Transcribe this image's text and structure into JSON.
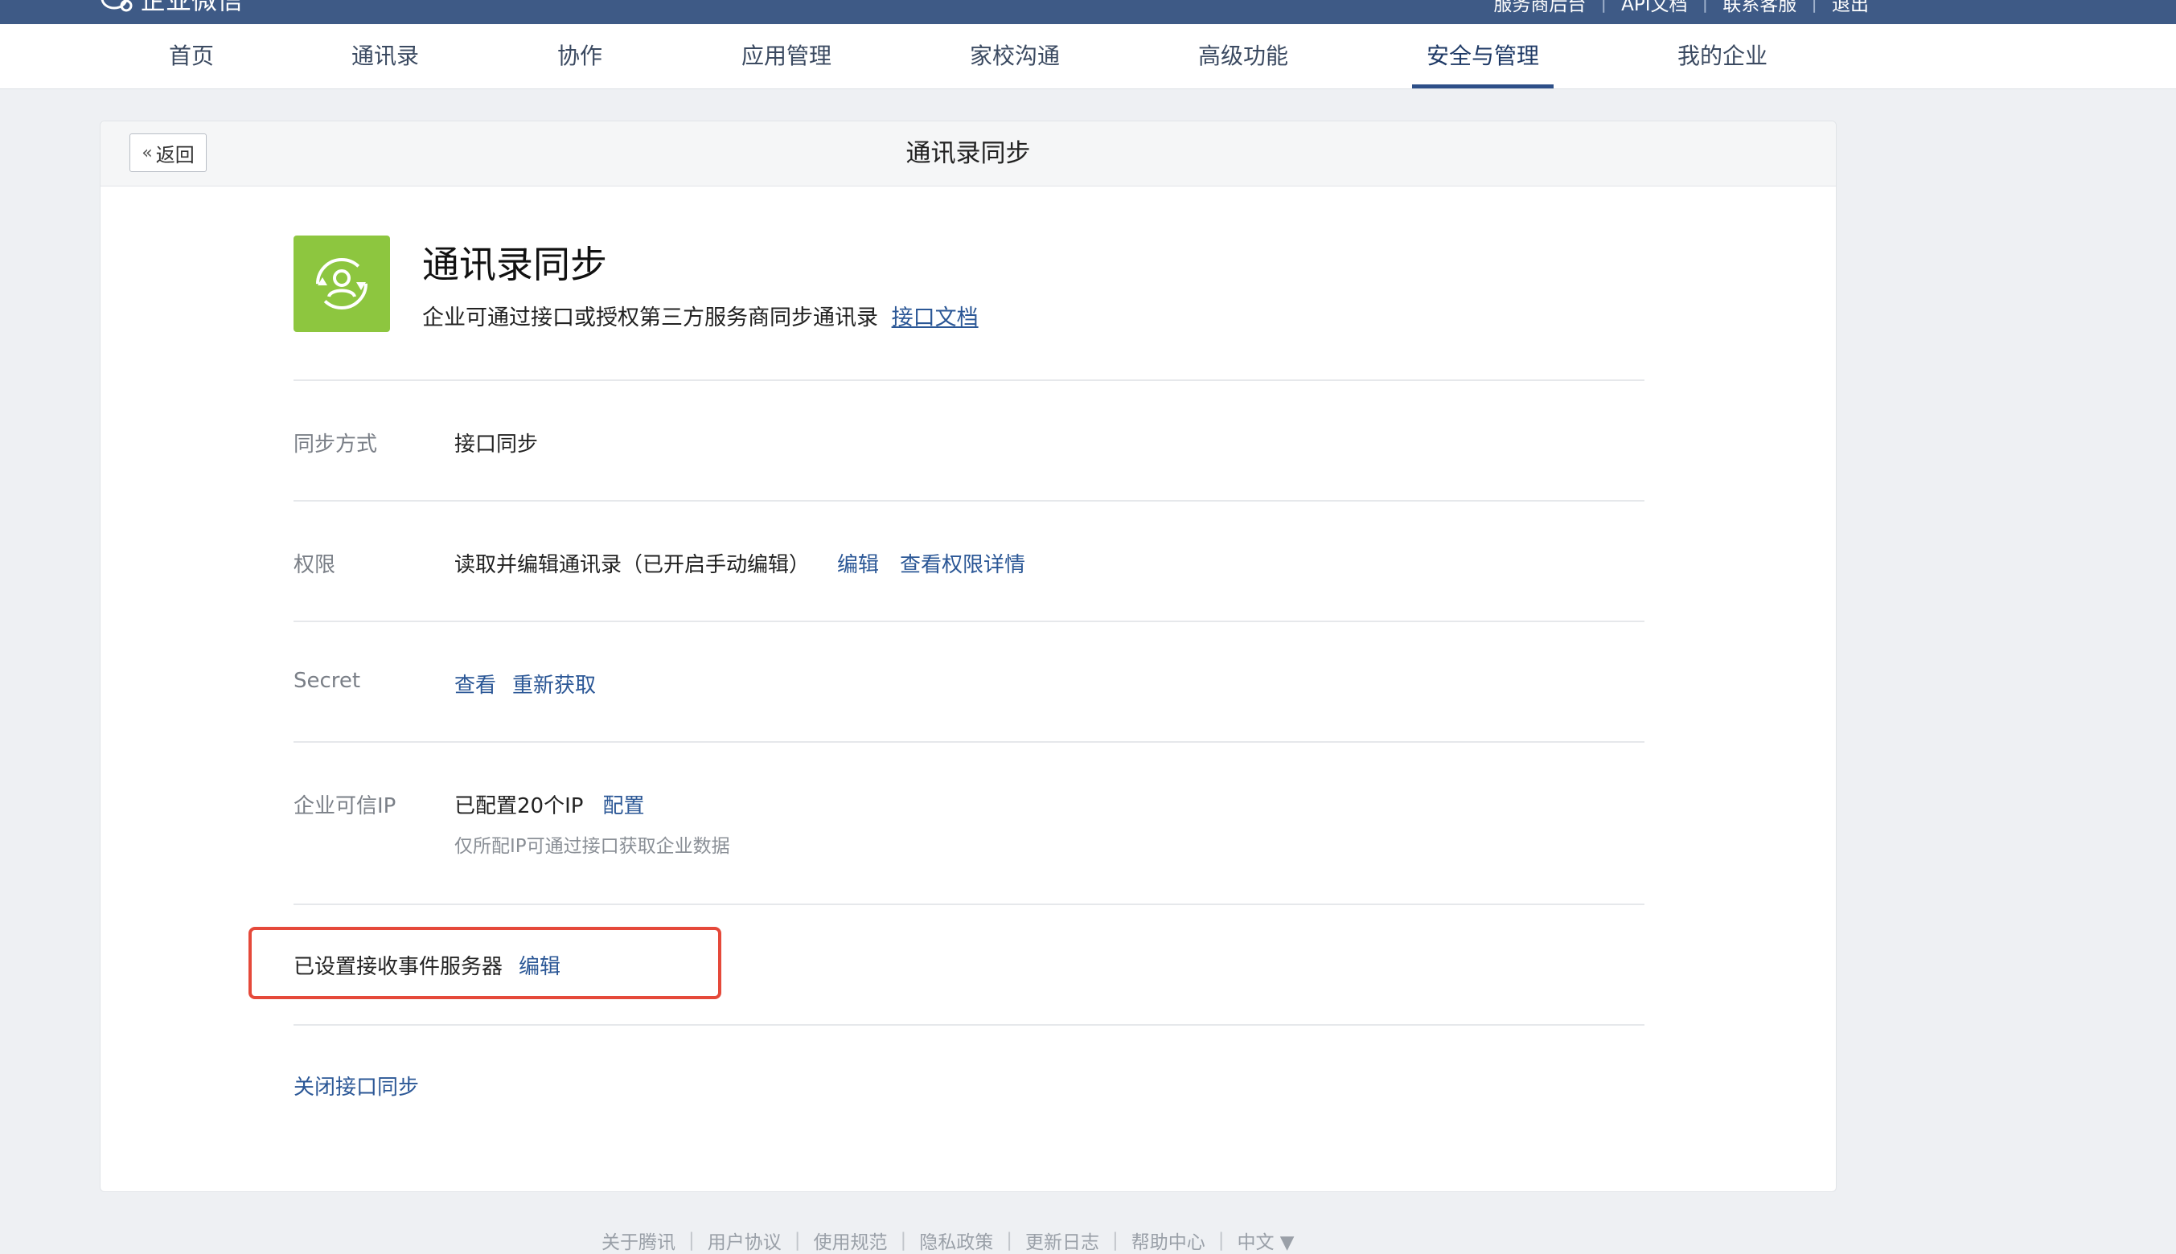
{
  "topbar": {
    "logo_text": "企业微信",
    "logo_badge": "",
    "links": [
      "服务商后台",
      "API文档",
      "联系客服",
      "退出"
    ]
  },
  "nav": {
    "items": [
      "首页",
      "通讯录",
      "协作",
      "应用管理",
      "家校沟通",
      "高级功能",
      "安全与管理",
      "我的企业"
    ],
    "active": "安全与管理"
  },
  "card": {
    "back_label": "返回",
    "header_title": "通讯录同步",
    "app": {
      "title": "通讯录同步",
      "description": "企业可通过接口或授权第三方服务商同步通讯录",
      "doc_link": "接口文档"
    },
    "sync_mode": {
      "label": "同步方式",
      "value": "接口同步"
    },
    "permission": {
      "label": "权限",
      "value": "读取并编辑通讯录（已开启手动编辑）",
      "edit_link": "编辑",
      "detail_link": "查看权限详情"
    },
    "secret": {
      "label": "Secret",
      "view_link": "查看",
      "refresh_link": "重新获取"
    },
    "trusted_ip": {
      "label": "企业可信IP",
      "value": "已配置20个IP",
      "config_link": "配置",
      "note": "仅所配IP可通过接口获取企业数据"
    },
    "event_server": {
      "text": "已设置接收事件服务器",
      "edit_link": "编辑"
    },
    "close_link": "关闭接口同步"
  },
  "footer": {
    "links": [
      "关于腾讯",
      "用户协议",
      "使用规范",
      "隐私政策",
      "更新日志",
      "帮助中心",
      "中文 ▼"
    ]
  },
  "colors": {
    "topbar": "#3e5a86",
    "link": "#2b5796",
    "app_icon": "#8dc63f",
    "highlight": "#e5493a"
  }
}
